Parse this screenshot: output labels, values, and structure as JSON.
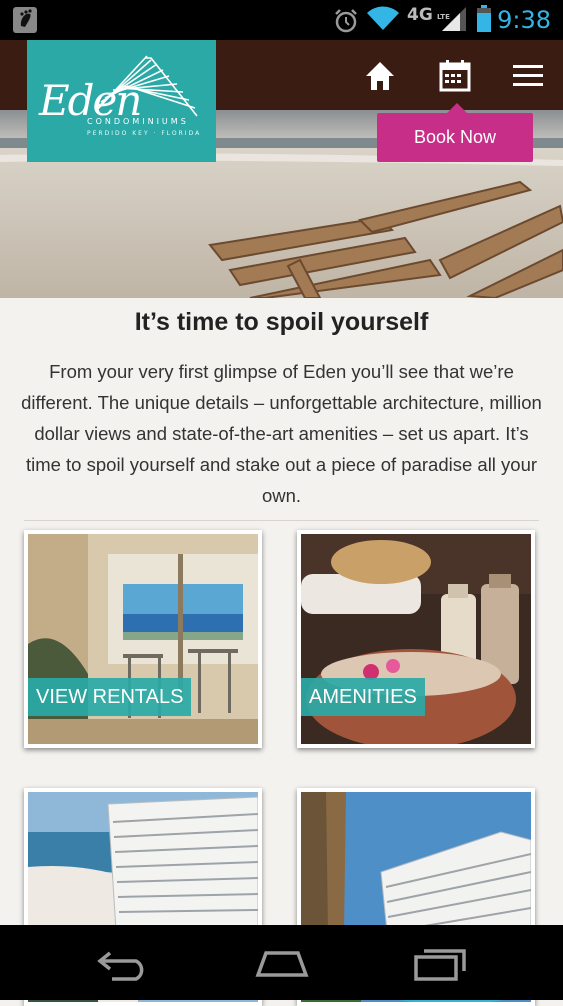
{
  "status_bar": {
    "time": "9:38",
    "network": "4G",
    "network_sub": "LTE",
    "icons": [
      "notification-icon",
      "alarm-icon",
      "wifi-icon",
      "signal-icon",
      "battery-icon"
    ]
  },
  "header": {
    "logo_script": "Eden",
    "logo_sub": "CONDOMINIUMS",
    "logo_tag": "PERDIDO KEY · FLORIDA",
    "book_label": "Book Now",
    "nav_icons": [
      "home-icon",
      "calendar-icon",
      "menu-icon"
    ]
  },
  "main": {
    "title": "It’s time to spoil yourself",
    "intro": "From your very first glimpse of Eden you’ll see that we’re different. The unique details – unforgettable architecture, million dollar views and state-of-the-art amenities – set us apart. It’s time to spoil yourself and stake out a piece of paradise all your own.",
    "tiles": [
      {
        "label": "VIEW RENTALS"
      },
      {
        "label": "AMENITIES"
      },
      {
        "label": ""
      },
      {
        "label": ""
      }
    ]
  },
  "colors": {
    "brand_teal": "#2aa9a6",
    "accent_pink": "#c72e88",
    "header_brown": "#3a1c12"
  }
}
